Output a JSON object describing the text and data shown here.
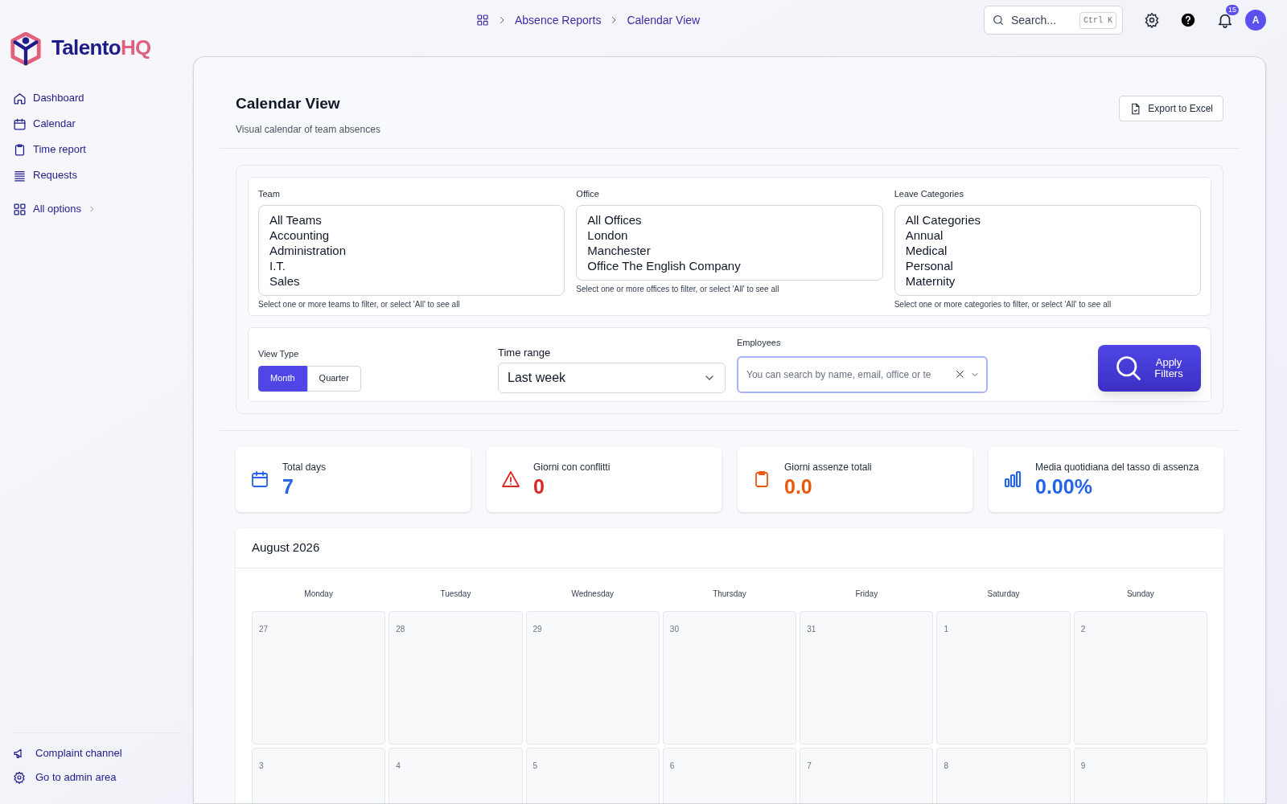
{
  "brand": {
    "name": "Talento",
    "accent": "HQ"
  },
  "sidebar": {
    "items": [
      {
        "label": "Dashboard",
        "kind": "home"
      },
      {
        "label": "Calendar",
        "kind": "calendar"
      },
      {
        "label": "Time report",
        "kind": "clipboard"
      },
      {
        "label": "Requests",
        "kind": "stack"
      },
      {
        "label": "All options",
        "kind": "grid",
        "more": true
      }
    ],
    "bottom_items": [
      {
        "label": "Complaint channel",
        "kind": "megaphone"
      },
      {
        "label": "Go to admin area",
        "kind": "gear"
      }
    ]
  },
  "breadcrumb": [
    "Absence Reports",
    "Calendar View"
  ],
  "search": {
    "placeholder": "Search...",
    "shortcut": "Ctrl K"
  },
  "notifications": {
    "count": "15"
  },
  "avatar": "A",
  "page": {
    "title": "Calendar View",
    "subtitle": "Visual calendar of team absences",
    "export_button": "Export to Excel"
  },
  "filters": [
    {
      "label": "Team",
      "options": [
        "All Teams",
        "Accounting",
        "Administration",
        "I.T.",
        "Sales"
      ],
      "hint": "Select one or more teams to filter, or select 'All' to see all"
    },
    {
      "label": "Office",
      "options": [
        "All Offices",
        "London",
        "Manchester",
        "Office The English Company"
      ],
      "hint": "Select one or more offices to filter, or select 'All' to see all"
    },
    {
      "label": "Leave Categories",
      "options": [
        "All Categories",
        "Annual",
        "Medical",
        "Personal",
        "Maternity"
      ],
      "hint": "Select one or more categories to filter, or select 'All' to see all"
    }
  ],
  "view_type": {
    "label": "View Type",
    "options": [
      {
        "label": "Month",
        "selected": true
      },
      {
        "label": "Quarter",
        "selected": false
      }
    ]
  },
  "time_range": {
    "label": "Time range",
    "value": "Last week"
  },
  "employees": {
    "label": "Employees",
    "placeholder": "You can search by name, email, office or te"
  },
  "apply_button": "Apply Filters",
  "stats": [
    {
      "label": "Total days",
      "value": "7",
      "kind": "calendar",
      "color": "#2563eb"
    },
    {
      "label": "Giorni con conflitti",
      "value": "0",
      "kind": "warning",
      "color": "#dc2626"
    },
    {
      "label": "Giorni assenze totali",
      "value": "0.0",
      "kind": "clipboard",
      "color": "#ea580c"
    },
    {
      "label": "Media quotidiana del tasso di assenza",
      "value": "0.00%",
      "kind": "chart",
      "color": "#2563eb"
    }
  ],
  "calendar": {
    "month": "August 2026",
    "weekdays": [
      "Monday",
      "Tuesday",
      "Wednesday",
      "Thursday",
      "Friday",
      "Saturday",
      "Sunday"
    ],
    "weeks": [
      [
        "27",
        "28",
        "29",
        "30",
        "31",
        "1",
        "2"
      ],
      [
        "3",
        "4",
        "5",
        "6",
        "7",
        "8",
        "9"
      ]
    ]
  }
}
